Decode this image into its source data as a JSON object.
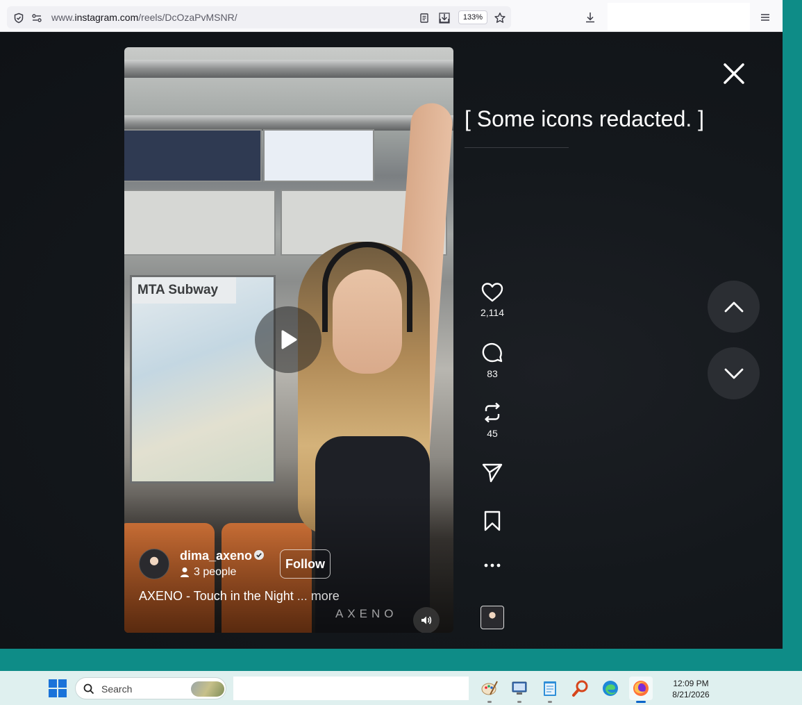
{
  "browser": {
    "url_prefix": "www.",
    "url_domain": "instagram.com",
    "url_path": "/reels/DcOzaPvMSNR/",
    "zoom": "133%"
  },
  "reel": {
    "username": "dima_axeno",
    "people": "3 people",
    "follow_label": "Follow",
    "caption": "AXENO - Touch in the Night",
    "caption_more": "... more",
    "watermark": "AXENO",
    "video_texts": {
      "map_title": "MTA Subway"
    }
  },
  "overlay": {
    "redacted_notice": "[ Some icons redacted. ]"
  },
  "actions": {
    "likes": "2,114",
    "comments": "83",
    "reposts": "45"
  },
  "taskbar": {
    "search_label": "Search",
    "time": "12:09 PM",
    "date": "8/21/2026"
  },
  "icons": [
    "shield-icon",
    "permissions-icon",
    "reader-view-icon",
    "save-page-icon",
    "bookmark-star-icon",
    "downloads-icon",
    "menu-icon",
    "close-icon",
    "play-icon",
    "verified-icon",
    "person-icon",
    "volume-icon",
    "heart-icon",
    "comment-icon",
    "repost-icon",
    "share-icon",
    "save-icon",
    "more-icon",
    "chevron-up-icon",
    "chevron-down-icon",
    "windows-start-icon",
    "search-icon"
  ]
}
